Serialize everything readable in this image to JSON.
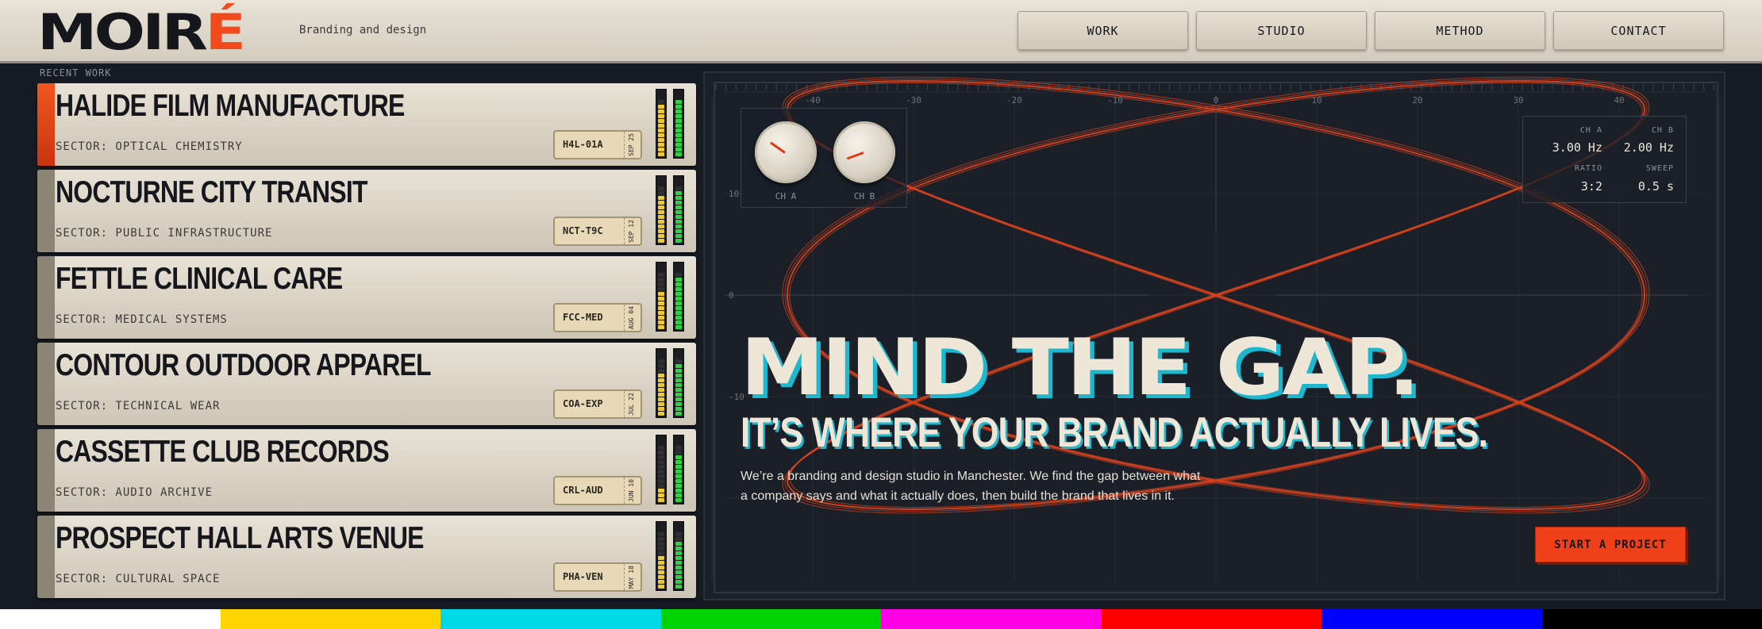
{
  "brand": {
    "logo_main": "MOIR",
    "logo_accent": "É",
    "tagline": "Branding and design"
  },
  "nav": [
    "WORK",
    "STUDIO",
    "METHOD",
    "CONTACT"
  ],
  "section_label": "RECENT WORK",
  "projects": [
    {
      "name": "HALIDE FILM MANUFACTURE",
      "sector": "SECTOR: OPTICAL CHEMISTRY",
      "code": "H4L-01A",
      "date": "SEP 25",
      "active": true,
      "level_a": 11,
      "level_b": 12
    },
    {
      "name": "NOCTURNE CITY TRANSIT",
      "sector": "SECTOR: PUBLIC INFRASTRUCTURE",
      "code": "NCT-T9C",
      "date": "SEP 12",
      "active": false,
      "level_a": 10,
      "level_b": 11
    },
    {
      "name": "FETTLE CLINICAL CARE",
      "sector": "SECTOR: MEDICAL SYSTEMS",
      "code": "FCC-MED",
      "date": "AUG 04",
      "active": false,
      "level_a": 8,
      "level_b": 11
    },
    {
      "name": "CONTOUR OUTDOOR APPAREL",
      "sector": "SECTOR: TECHNICAL WEAR",
      "code": "COA-EXP",
      "date": "JUL 22",
      "active": false,
      "level_a": 9,
      "level_b": 11
    },
    {
      "name": "CASSETTE CLUB RECORDS",
      "sector": "SECTOR: AUDIO ARCHIVE",
      "code": "CRL-AUD",
      "date": "JUN 10",
      "active": false,
      "level_a": 3,
      "level_b": 10
    },
    {
      "name": "PROSPECT HALL ARTS VENUE",
      "sector": "SECTOR: CULTURAL SPACE",
      "code": "PHA-VEN",
      "date": "MAY 18",
      "active": false,
      "level_a": 7,
      "level_b": 10
    }
  ],
  "scope": {
    "x_ticks": [
      "-40",
      "-30",
      "-20",
      "-10",
      "0",
      "10",
      "20",
      "30",
      "40"
    ],
    "y_ticks": [
      "10",
      "0",
      "-10"
    ],
    "knob_a_label": "CH A",
    "knob_b_label": "CH B",
    "readout": {
      "ch_a_label": "CH A",
      "ch_a_value": "3.00 Hz",
      "ch_b_label": "CH B",
      "ch_b_value": "2.00 Hz",
      "ratio_label": "RATIO",
      "ratio_value": "3:2",
      "sweep_label": "SWEEP",
      "sweep_value": "0.5 s"
    }
  },
  "hero": {
    "title": "MIND THE GAP.",
    "subtitle": "IT’S WHERE YOUR BRAND ACTUALLY LIVES.",
    "body_line1": "We’re a branding and design studio in Manchester. We find the gap between what",
    "body_line2": "a company says and what it actually does, then build the brand that lives in it.",
    "cta": "START A PROJECT"
  },
  "colors": {
    "accent": "#f04a1d",
    "trace": "#e0441d",
    "hero_shadow": "#1bb8cf",
    "test_bars": [
      "#ffffff",
      "#ffd500",
      "#00d9e6",
      "#00d400",
      "#ff00e6",
      "#ff0000",
      "#0000ff",
      "#000000"
    ]
  }
}
